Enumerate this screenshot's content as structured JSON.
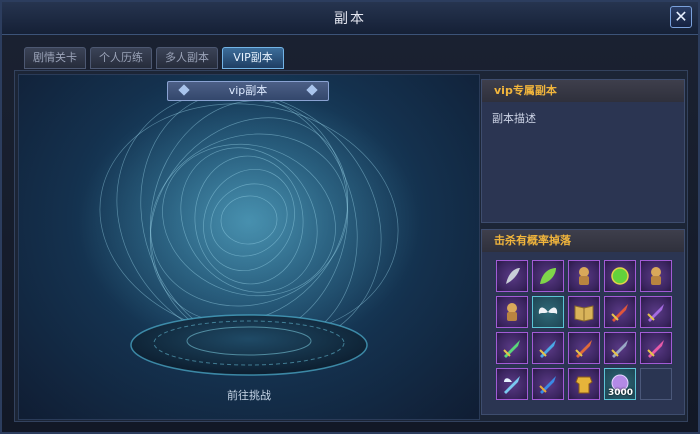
{
  "window": {
    "title": "副本"
  },
  "tabs": [
    {
      "label": "剧情关卡",
      "active": false
    },
    {
      "label": "个人历练",
      "active": false
    },
    {
      "label": "多人副本",
      "active": false
    },
    {
      "label": "VIP副本",
      "active": true
    }
  ],
  "scene": {
    "banner": "vip副本",
    "goto_label": "前往挑战"
  },
  "info_panel": {
    "title": "vip专属副本",
    "description": "副本描述"
  },
  "drops_panel": {
    "title": "击杀有概率掉落",
    "items": [
      {
        "icon": "feather-icon",
        "count": ""
      },
      {
        "icon": "leaf-icon",
        "count": ""
      },
      {
        "icon": "idol-icon",
        "count": ""
      },
      {
        "icon": "green-orb-icon",
        "count": ""
      },
      {
        "icon": "idol-icon",
        "count": ""
      },
      {
        "icon": "idol-icon",
        "count": ""
      },
      {
        "icon": "wings-icon",
        "count": ""
      },
      {
        "icon": "book-icon",
        "count": ""
      },
      {
        "icon": "sword-icon",
        "count": ""
      },
      {
        "icon": "sword-icon",
        "count": ""
      },
      {
        "icon": "sword-icon",
        "count": ""
      },
      {
        "icon": "sword-icon",
        "count": ""
      },
      {
        "icon": "sword-icon",
        "count": ""
      },
      {
        "icon": "sword-icon",
        "count": ""
      },
      {
        "icon": "sword-icon",
        "count": ""
      },
      {
        "icon": "winged-sword-icon",
        "count": ""
      },
      {
        "icon": "sword-icon",
        "count": ""
      },
      {
        "icon": "armor-icon",
        "count": ""
      },
      {
        "icon": "purple-crystal-icon",
        "count": "3000"
      },
      {
        "icon": "empty-slot",
        "count": ""
      }
    ]
  }
}
